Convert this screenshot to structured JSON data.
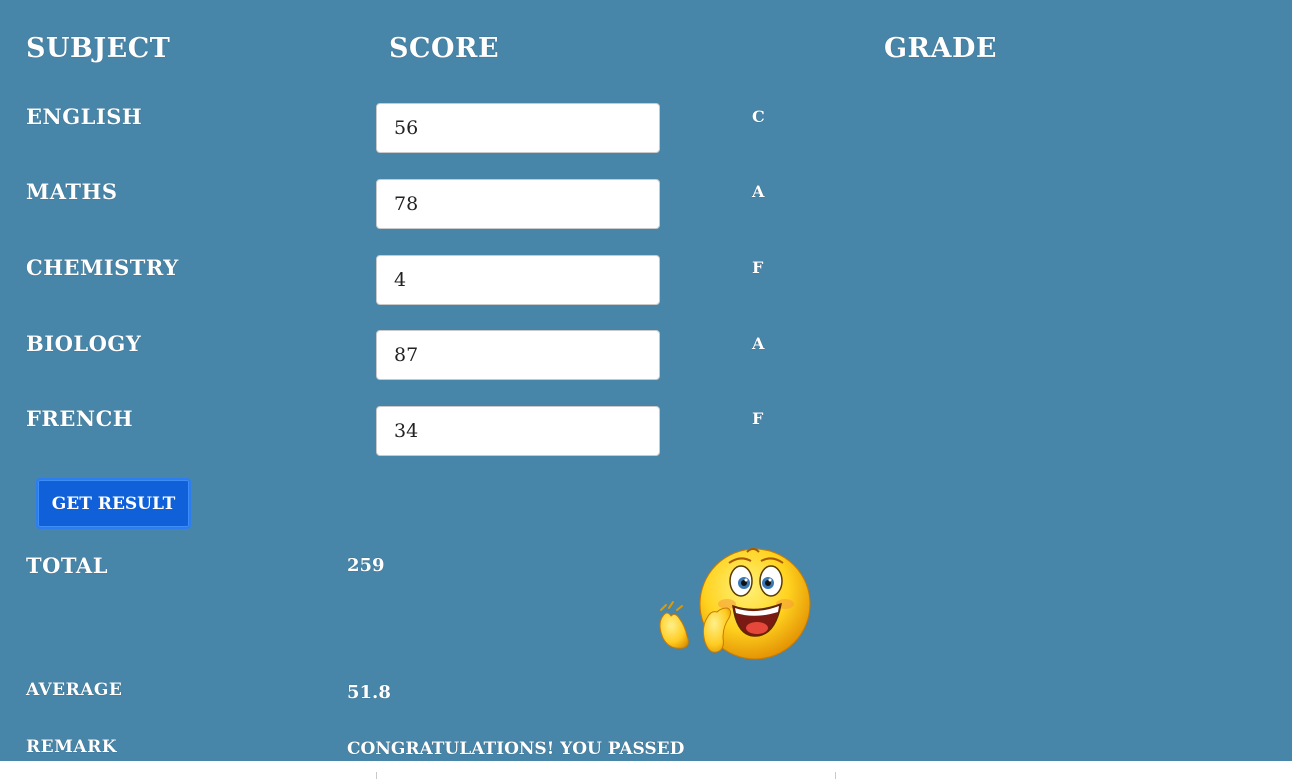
{
  "headers": {
    "subject": "SUBJECT",
    "score": "SCORE",
    "grade": "GRADE"
  },
  "subjects": [
    {
      "name": "ENGLISH",
      "score": "56",
      "grade": "C"
    },
    {
      "name": "MATHS",
      "score": "78",
      "grade": "A"
    },
    {
      "name": "CHEMISTRY",
      "score": "4",
      "grade": "F"
    },
    {
      "name": "BIOLOGY",
      "score": "87",
      "grade": "A"
    },
    {
      "name": "FRENCH",
      "score": "34",
      "grade": "F"
    }
  ],
  "actions": {
    "get_result_label": "GET RESULT"
  },
  "results": {
    "total_label": "TOTAL",
    "total_value": "259",
    "average_label": "AVERAGE",
    "average_value": "51.8",
    "remark_label": "REMARK",
    "remark_value": "CONGRATULATIONS! YOU PASSED"
  },
  "icons": {
    "result_emoji": "clapping-smiley-icon"
  },
  "colors": {
    "background": "#4886a9",
    "button": "#1061d9",
    "text": "#ffffff"
  }
}
